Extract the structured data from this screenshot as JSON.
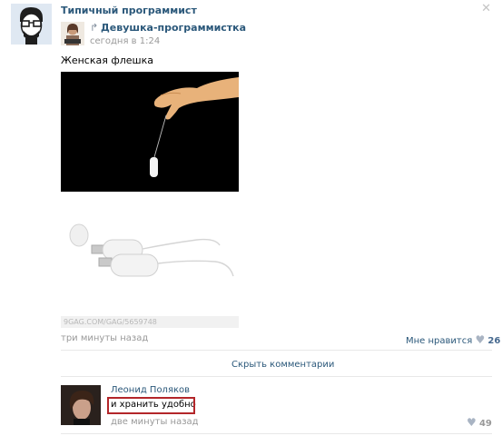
{
  "post": {
    "author": "Типичный программист",
    "repost": {
      "author": "Девушка-программистка",
      "time": "сегодня в 1:24"
    },
    "text": "Женская флешка",
    "photo2_caption": "9GAG.COM/GAG/5659748",
    "time": "три минуты назад",
    "like_label": "Мне нравится",
    "likes": "26"
  },
  "comments": {
    "hide_label": "Скрыть комментарии",
    "items": [
      {
        "author": "Леонид Поляков",
        "text": "и хранить удобно",
        "time": "две минуты назад",
        "likes": "49"
      }
    ]
  },
  "icons": {
    "close": "close-icon",
    "repost": "repost-icon",
    "heart": "heart-icon"
  }
}
